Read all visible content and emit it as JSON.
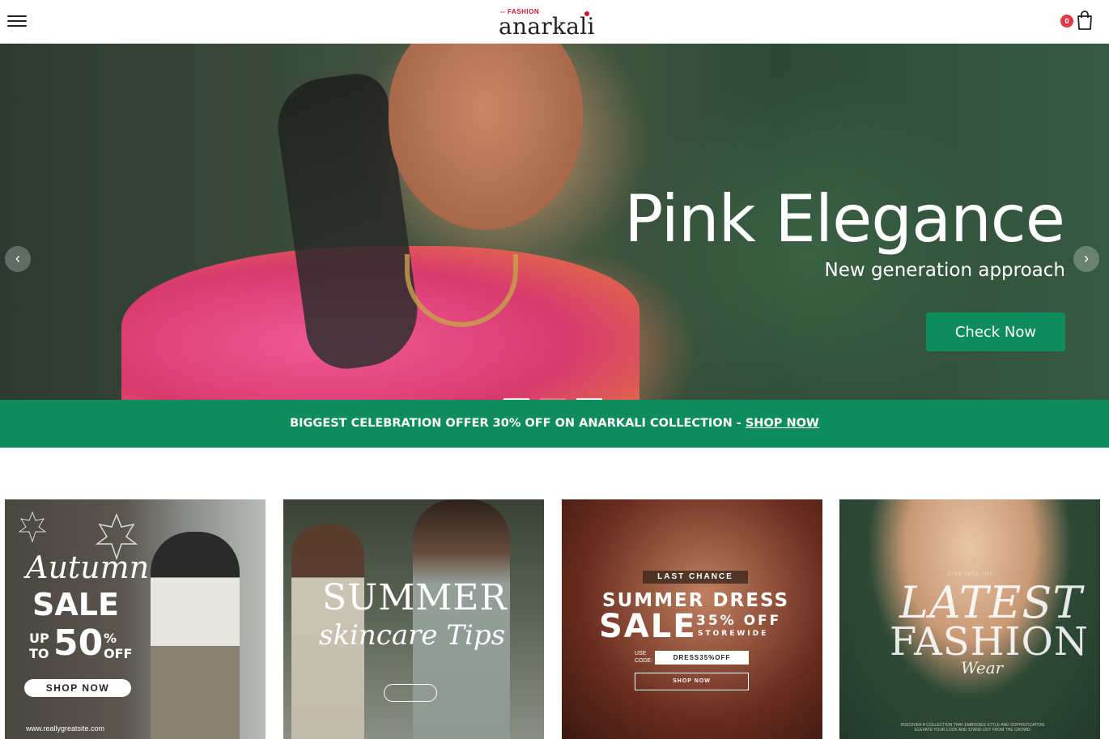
{
  "header": {
    "logo_small": "-- FASHION",
    "logo_main": "anarkali",
    "cart_count": "0",
    "icons": {
      "menu": "hamburger-menu-icon",
      "cart": "shopping-bag-icon"
    }
  },
  "hero": {
    "title": "Pink Elegance",
    "subtitle": "New generation approach",
    "cta_label": "Check Now",
    "prev_arrow": "‹",
    "next_arrow": "›",
    "slides_count": 3,
    "active_slide": 2
  },
  "promo": {
    "text": "BIGGEST CELEBRATION OFFER 30% OFF ON ANARKALI COLLECTION - ",
    "link_label": "SHOP NOW"
  },
  "cards": [
    {
      "script_text": "Autumn",
      "sale_text": "SALE",
      "upto_line1": "UP",
      "upto_line2": "TO",
      "percent": "50",
      "percent_sign": "%",
      "off_text": "OFF",
      "button_label": "SHOP NOW",
      "url_text": "www.reallygreatsite.com"
    },
    {
      "title_text": "SUMMER",
      "script_text": "skincare Tips"
    },
    {
      "tag_text": "LAST CHANCE",
      "title_text": "SUMMER DRESS",
      "sale_text": "SALE",
      "percent_text": "35% OFF",
      "storewide_text": "STOREWIDE",
      "use_code_label": "USE CODE:",
      "code_text": "DRESS35%OFF",
      "button_label": "SHOP NOW"
    },
    {
      "small_text": "DIVE INTO THE",
      "title_text": "LATEST",
      "subtitle_text": "FASHION",
      "script_text": "Wear",
      "fine_print": "DISCOVER A COLLECTION THAT EMBODIES STYLE AND SOPHISTICATION. ELEVATE YOUR LOOK AND STAND OUT FROM THE CROWD."
    }
  ]
}
